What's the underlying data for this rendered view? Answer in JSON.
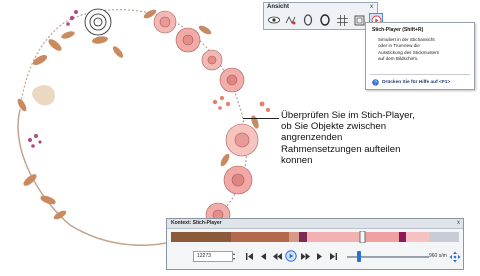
{
  "toolbar": {
    "title": "Ansicht",
    "close_label": "x",
    "tools": [
      "eye-icon",
      "stitch-filter-icon",
      "outline-icon",
      "oval-icon",
      "grid-icon",
      "frame-icon",
      "play-icon"
    ]
  },
  "tooltip": {
    "title": "Stich-Player (Shift+R)",
    "body_lines": [
      "Simuliert in der Stichansicht",
      "oder in TrueView die",
      "Ausstickung des Stickmusters",
      "auf dem Bildschirm."
    ],
    "help": "Drücken Sie für Hilfe auf <F1>"
  },
  "callout": {
    "lines": [
      "Überprüfen Sie im Stich-Player,",
      "ob Sie Objekte zwischen",
      "angrenzenden",
      "Rahmensetzungen aufteilen",
      "konnen"
    ]
  },
  "player": {
    "title": "Kontext: Stich-Player",
    "close_label": "x",
    "frame_value": "12273",
    "speed_label": "960 s/m",
    "timeline_colors": [
      "#8a5a3a",
      "#b36a4c",
      "#d89a86",
      "#7a2a55",
      "#f3b2b2",
      "#f0a0a0",
      "#8b1a5a",
      "#f6c1c1",
      "#c8ccd6"
    ]
  },
  "colors": {
    "accent": "#2e6fd6",
    "rose": "#f0a0a0",
    "leaf": "#c98a60"
  }
}
